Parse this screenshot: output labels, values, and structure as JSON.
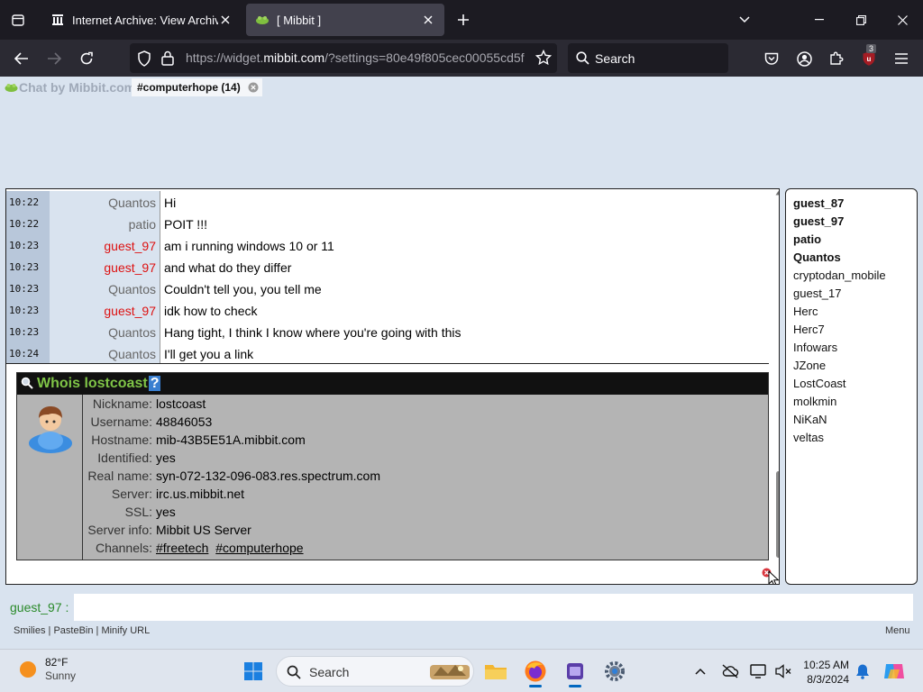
{
  "browser": {
    "tabs": [
      {
        "title": "Internet Archive: View Archive",
        "active": false
      },
      {
        "title": "[ Mibbit ]",
        "active": true
      }
    ],
    "url_prefix": "https://widget.",
    "url_domain": "mibbit.com",
    "url_rest": "/?settings=80e49f805cec00055cd5f",
    "search_placeholder": "Search",
    "extension_badge": "3"
  },
  "chat": {
    "logo_text": "Chat by Mibbit.com",
    "channel_tab": "#computerhope (14)",
    "messages": [
      {
        "time": "10:22",
        "nick": "Quantos",
        "text": "Hi",
        "color": "#666666"
      },
      {
        "time": "10:22",
        "nick": "patio",
        "text": "POIT !!!",
        "color": "#666666"
      },
      {
        "time": "10:23",
        "nick": "guest_97",
        "text": "am i running windows 10 or 11",
        "color": "#dd1111"
      },
      {
        "time": "10:23",
        "nick": "guest_97",
        "text": "and what do they differ",
        "color": "#dd1111"
      },
      {
        "time": "10:23",
        "nick": "Quantos",
        "text": "Couldn't tell you, you tell me",
        "color": "#666666"
      },
      {
        "time": "10:23",
        "nick": "guest_97",
        "text": "idk how to check",
        "color": "#dd1111"
      },
      {
        "time": "10:23",
        "nick": "Quantos",
        "text": "Hang tight, I think I know where you're going with this",
        "color": "#666666"
      },
      {
        "time": "10:24",
        "nick": "Quantos",
        "text": "I'll get you a link",
        "color": "#666666"
      }
    ],
    "whois": {
      "title": "Whois lostcoast",
      "help": "?",
      "rows": [
        {
          "label": "Nickname:",
          "value": "lostcoast"
        },
        {
          "label": "Username:",
          "value": "48846053"
        },
        {
          "label": "Hostname:",
          "value": "mib-43B5E51A.mibbit.com"
        },
        {
          "label": "Identified:",
          "value": "yes"
        },
        {
          "label": "Real name:",
          "value": "syn-072-132-096-083.res.spectrum.com"
        },
        {
          "label": "Server:",
          "value": "irc.us.mibbit.net"
        },
        {
          "label": "SSL:",
          "value": "yes"
        },
        {
          "label": "Server info:",
          "value": "Mibbit US Server"
        }
      ],
      "channels_label": "Channels:",
      "channels": [
        "#freetech",
        "#computerhope"
      ]
    },
    "users": [
      {
        "name": "guest_87",
        "op": true
      },
      {
        "name": "guest_97",
        "op": true
      },
      {
        "name": "patio",
        "op": true
      },
      {
        "name": "Quantos",
        "op": true
      },
      {
        "name": "cryptodan_mobile",
        "op": false
      },
      {
        "name": "guest_17",
        "op": false
      },
      {
        "name": "Herc",
        "op": false
      },
      {
        "name": "Herc7",
        "op": false
      },
      {
        "name": "Infowars",
        "op": false
      },
      {
        "name": "JZone",
        "op": false
      },
      {
        "name": "LostCoast",
        "op": false
      },
      {
        "name": "molkmin",
        "op": false
      },
      {
        "name": "NiKaN",
        "op": false
      },
      {
        "name": "veltas",
        "op": false
      }
    ],
    "my_nick": "guest_97 :",
    "footer": {
      "smilies": "Smilies",
      "pastebin": "PasteBin",
      "minify": "Minify URL",
      "sep": " | ",
      "menu": "Menu"
    }
  },
  "taskbar": {
    "temperature": "82°F",
    "condition": "Sunny",
    "search": "Search",
    "time": "10:25 AM",
    "date": "8/3/2024"
  },
  "colors": {
    "accent": "#0067c0",
    "whois_title": "#7fc447",
    "my_nick": "#2a8a2a"
  }
}
